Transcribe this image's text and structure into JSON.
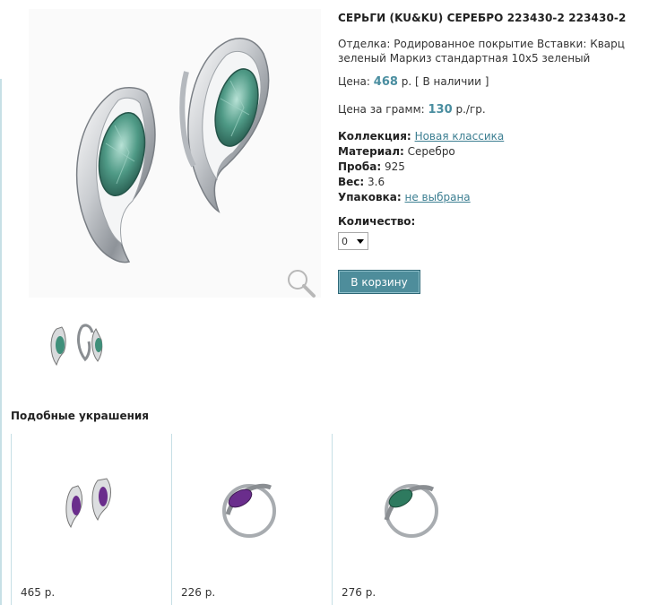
{
  "product": {
    "title": "СЕРЬГИ (KU&KU) СЕРЕБРО 223430-2 223430-2",
    "finish": "Отделка: Родированное покрытие Вставки: Кварц зеленый Маркиз стандартная 10х5 зеленый",
    "price_label": "Цена:",
    "price_value": "468",
    "price_unit": "р.",
    "availability": "[ В наличии ]",
    "gram_label": "Цена за грамм:",
    "gram_value": "130",
    "gram_unit": "р./гр.",
    "collection_label": "Коллекция:",
    "collection_value": "Новая классика",
    "material_label": "Материал:",
    "material_value": "Серебро",
    "probe_label": "Проба:",
    "probe_value": "925",
    "weight_label": "Вес:",
    "weight_value": "3.6",
    "package_label": "Упаковка:",
    "package_value": "не выбрана",
    "qty_label": "Количество:",
    "qty_value": "0",
    "cart_button": "В корзину"
  },
  "similar": {
    "title": "Подобные украшения",
    "items": [
      {
        "price": "465 р.",
        "gem_color": "#6a2d8c"
      },
      {
        "price": "226 р.",
        "gem_color": "#6a2d8c"
      },
      {
        "price": "276 р.",
        "gem_color": "#2e7a5f"
      }
    ]
  },
  "colors": {
    "accent": "#4e8d9b",
    "link": "#3d7f92",
    "gem_green": "#3f8f7a"
  }
}
